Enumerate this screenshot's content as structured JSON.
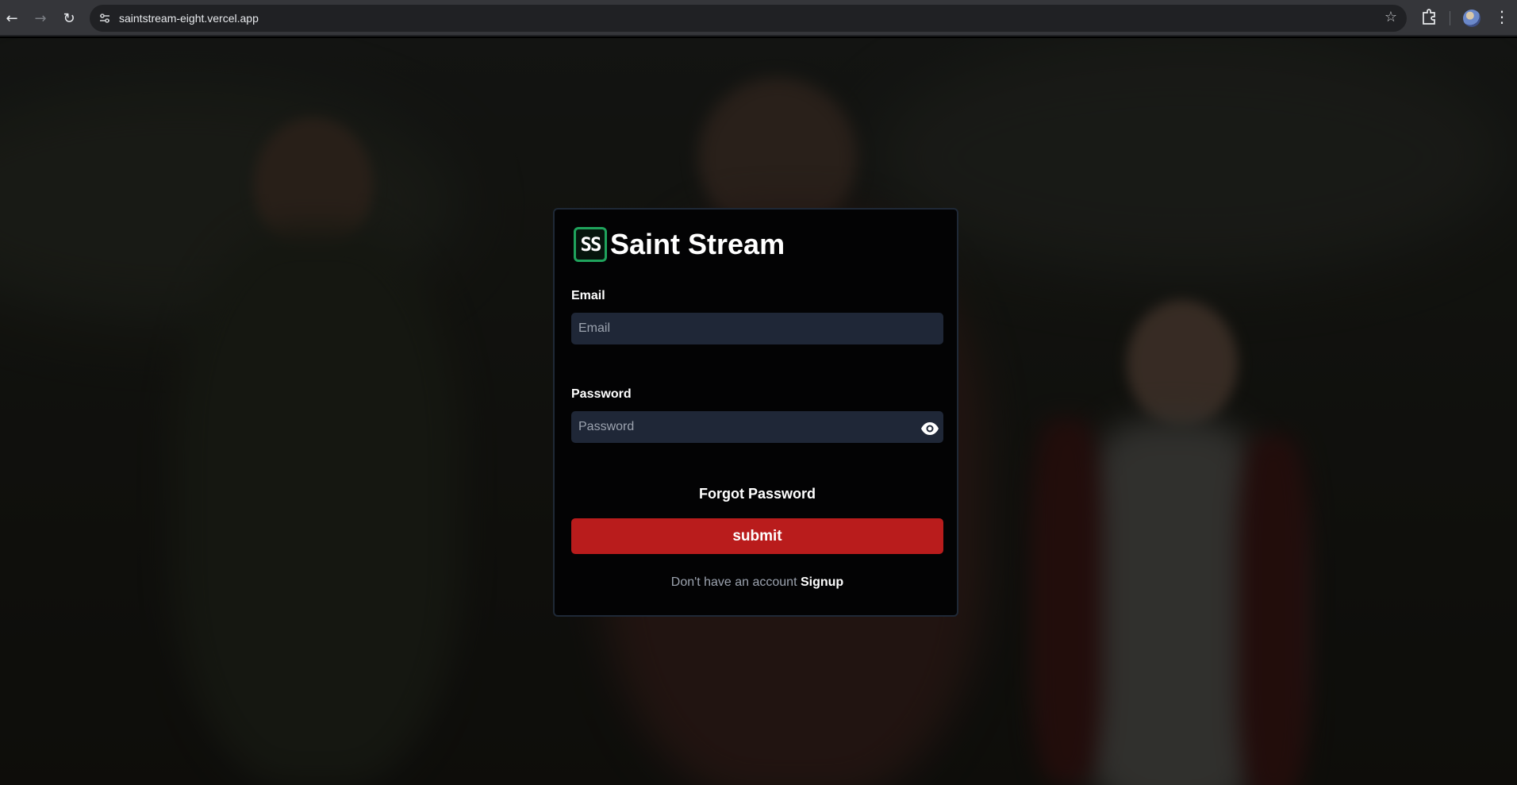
{
  "browser": {
    "url": "saintstream-eight.vercel.app",
    "back_icon": "arrow-left-icon",
    "forward_icon": "arrow-right-icon",
    "reload_icon": "reload-icon",
    "site_info_icon": "tune-icon",
    "bookmark_icon": "star-icon",
    "extensions_icon": "puzzle-icon",
    "menu_icon": "kebab-menu-icon"
  },
  "brand": {
    "mark": "SS",
    "name": "Saint Stream",
    "accent": "#1fa35c"
  },
  "form": {
    "email_label": "Email",
    "email_placeholder": "Email",
    "email_value": "",
    "password_label": "Password",
    "password_placeholder": "Password",
    "password_value": "",
    "show_password_icon": "eye-icon",
    "forgot_label": "Forgot Password",
    "submit_label": "submit",
    "submit_color": "#b91c1c",
    "signup_prompt": "Don't have an account",
    "signup_link": "Signup"
  }
}
